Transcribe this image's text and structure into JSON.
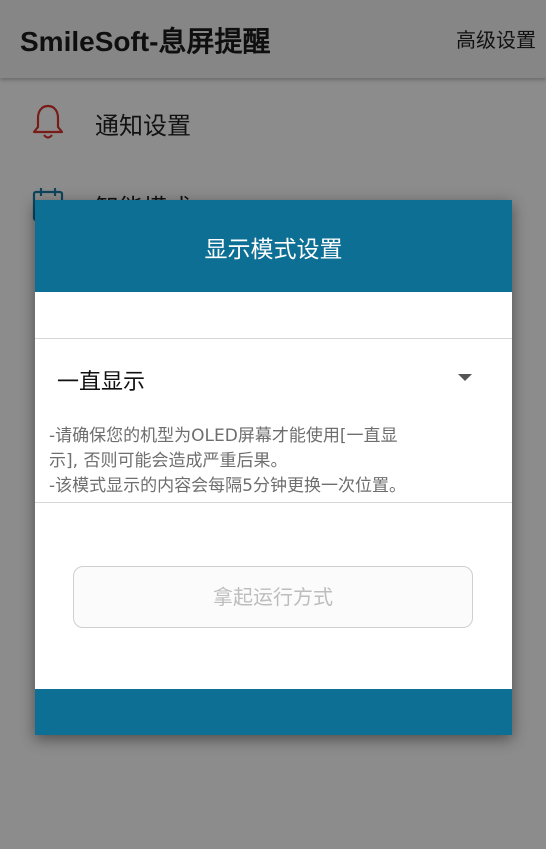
{
  "appbar": {
    "title": "SmileSoft-息屏提醒",
    "action_label": "高级设置"
  },
  "list": {
    "items": [
      {
        "label": "通知设置",
        "icon": "bell-icon"
      },
      {
        "label": "智能模式",
        "icon": "calendar-icon"
      }
    ]
  },
  "dialog": {
    "title": "显示模式设置",
    "select": {
      "value": "一直显示"
    },
    "warning": {
      "line1": "-请确保您的机型为OLED屏幕才能使用[一直显",
      "line2": "示], 否则可能会造成严重后果。",
      "line3": "-该模式显示的内容会每隔5分钟更换一次位置。"
    },
    "button_label": "拿起运行方式"
  },
  "colors": {
    "accent": "#0d6f94",
    "icon_red": "#d9342b"
  }
}
